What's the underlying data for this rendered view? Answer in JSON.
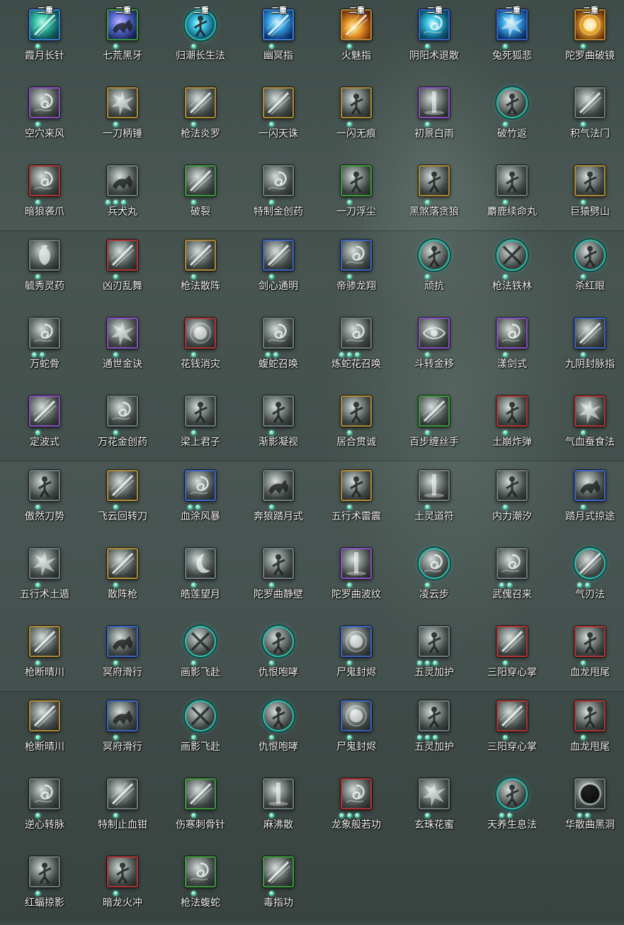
{
  "rows": [
    [
      {
        "label": "霞月长针",
        "tier": "二重",
        "shape": "square",
        "color": "c-teal",
        "border": "b-cyanblue",
        "dots": 1,
        "glyph": "slash"
      },
      {
        "label": "七荒黑牙",
        "tier": "二重",
        "shape": "square",
        "color": "c-purple",
        "border": "b-green",
        "dots": 1,
        "glyph": "beast"
      },
      {
        "label": "归潮长生法",
        "tier": "二重",
        "shape": "round",
        "color": "c-cyan",
        "border": "",
        "dots": 1,
        "glyph": "figure"
      },
      {
        "label": "幽冥指",
        "tier": "二重",
        "shape": "square",
        "color": "c-blue",
        "border": "b-cyanblue",
        "dots": 1,
        "glyph": "slash"
      },
      {
        "label": "火魅指",
        "tier": "二重",
        "shape": "square",
        "color": "c-orange",
        "border": "b-gold",
        "dots": 1,
        "glyph": "slash"
      },
      {
        "label": "阴阳术退散",
        "tier": "二重",
        "shape": "square",
        "color": "c-cyan",
        "border": "b-blue",
        "dots": 1,
        "glyph": "swirl"
      },
      {
        "label": "兔死狐悲",
        "tier": "二重",
        "shape": "square",
        "color": "c-blue",
        "border": "b-blue",
        "dots": 1,
        "glyph": "burst"
      },
      {
        "label": "陀罗曲破镜",
        "tier": "二重",
        "shape": "square",
        "color": "c-gold",
        "border": "b-gold",
        "dots": 1,
        "glyph": "orb"
      }
    ],
    [
      {
        "label": "空穴来风",
        "tier": "",
        "shape": "square",
        "color": "",
        "border": "b-purple",
        "dots": 1,
        "glyph": "swirl"
      },
      {
        "label": "一刀柄锤",
        "tier": "",
        "shape": "square",
        "color": "",
        "border": "b-gold",
        "dots": 1,
        "glyph": "burst"
      },
      {
        "label": "枪法炎罗",
        "tier": "",
        "shape": "square",
        "color": "",
        "border": "b-gold",
        "dots": 1,
        "glyph": "slash"
      },
      {
        "label": "一闪天诛",
        "tier": "",
        "shape": "square",
        "color": "",
        "border": "b-gold",
        "dots": 1,
        "glyph": "slash"
      },
      {
        "label": "一闪无痕",
        "tier": "",
        "shape": "square",
        "color": "",
        "border": "b-gold",
        "dots": 1,
        "glyph": "figure"
      },
      {
        "label": "初景白雨",
        "tier": "",
        "shape": "square",
        "color": "",
        "border": "b-purple",
        "dots": 1,
        "glyph": "pillar"
      },
      {
        "label": "破竹返",
        "tier": "",
        "shape": "round",
        "color": "",
        "border": "",
        "dots": 1,
        "glyph": "figure"
      },
      {
        "label": "积气法门",
        "tier": "",
        "shape": "square",
        "color": "",
        "border": "b-gray",
        "dots": 1,
        "glyph": "slash"
      }
    ],
    [
      {
        "label": "暗狼袭爪",
        "tier": "",
        "shape": "square",
        "color": "",
        "border": "b-red",
        "dots": 1,
        "glyph": "swirl"
      },
      {
        "label": "兵犬丸",
        "tier": "",
        "shape": "square",
        "color": "",
        "border": "b-gray",
        "dots": 3,
        "glyph": "beast"
      },
      {
        "label": "破裂",
        "tier": "",
        "shape": "square",
        "color": "",
        "border": "b-green",
        "dots": 1,
        "glyph": "slash"
      },
      {
        "label": "特制金创药",
        "tier": "",
        "shape": "square",
        "color": "",
        "border": "b-gray",
        "dots": 1,
        "glyph": "swirl"
      },
      {
        "label": "一刀浮尘",
        "tier": "",
        "shape": "square",
        "color": "",
        "border": "b-green",
        "dots": 1,
        "glyph": "figure"
      },
      {
        "label": "黑煞落贪狼",
        "tier": "",
        "shape": "square",
        "color": "",
        "border": "b-gold",
        "dots": 1,
        "glyph": "figure"
      },
      {
        "label": "麝鹿续命丸",
        "tier": "",
        "shape": "square",
        "color": "",
        "border": "b-gray",
        "dots": 1,
        "glyph": "figure"
      },
      {
        "label": "巨猿劈山",
        "tier": "",
        "shape": "square",
        "color": "",
        "border": "b-gold",
        "dots": 1,
        "glyph": "figure"
      }
    ],
    [
      {
        "label": "毓秀灵药",
        "tier": "",
        "shape": "square",
        "color": "",
        "border": "b-gray",
        "dots": 1,
        "glyph": "vase"
      },
      {
        "label": "凶刃乱舞",
        "tier": "",
        "shape": "square",
        "color": "",
        "border": "b-red",
        "dots": 1,
        "glyph": "slash"
      },
      {
        "label": "枪法散阵",
        "tier": "",
        "shape": "square",
        "color": "",
        "border": "b-gold",
        "dots": 1,
        "glyph": "slash"
      },
      {
        "label": "剑心通明",
        "tier": "",
        "shape": "square",
        "color": "",
        "border": "b-blue",
        "dots": 1,
        "glyph": "slash"
      },
      {
        "label": "帝骖龙翔",
        "tier": "",
        "shape": "square",
        "color": "",
        "border": "b-blue",
        "dots": 1,
        "glyph": "swirl"
      },
      {
        "label": "顽抗",
        "tier": "",
        "shape": "round",
        "color": "",
        "border": "",
        "dots": 1,
        "glyph": "figure"
      },
      {
        "label": "枪法铁林",
        "tier": "",
        "shape": "round",
        "color": "",
        "border": "",
        "dots": 1,
        "glyph": "cross"
      },
      {
        "label": "杀红眼",
        "tier": "",
        "shape": "round",
        "color": "",
        "border": "",
        "dots": 1,
        "glyph": "figure"
      }
    ],
    [
      {
        "label": "万蛇骨",
        "tier": "",
        "shape": "square",
        "color": "",
        "border": "b-gray",
        "dots": 2,
        "glyph": "swirl"
      },
      {
        "label": "通世金诀",
        "tier": "",
        "shape": "square",
        "color": "",
        "border": "b-purple",
        "dots": 1,
        "glyph": "burst"
      },
      {
        "label": "花钱消灾",
        "tier": "",
        "shape": "square",
        "color": "",
        "border": "b-red",
        "dots": 1,
        "glyph": "orb"
      },
      {
        "label": "蝮蛇召唤",
        "tier": "",
        "shape": "square",
        "color": "",
        "border": "b-gray",
        "dots": 2,
        "glyph": "swirl"
      },
      {
        "label": "炼蛇花召唤",
        "tier": "",
        "shape": "square",
        "color": "",
        "border": "b-gray",
        "dots": 3,
        "glyph": "swirl"
      },
      {
        "label": "斗转金移",
        "tier": "",
        "shape": "square",
        "color": "",
        "border": "b-purple",
        "dots": 1,
        "glyph": "eye"
      },
      {
        "label": "漾剑式",
        "tier": "",
        "shape": "square",
        "color": "",
        "border": "b-purple",
        "dots": 1,
        "glyph": "swirl"
      },
      {
        "label": "九阴封脉指",
        "tier": "",
        "shape": "square",
        "color": "",
        "border": "b-blue",
        "dots": 1,
        "glyph": "slash"
      }
    ],
    [
      {
        "label": "定波式",
        "tier": "",
        "shape": "square",
        "color": "",
        "border": "b-purple",
        "dots": 1,
        "glyph": "slash"
      },
      {
        "label": "万花金创药",
        "tier": "",
        "shape": "square",
        "color": "",
        "border": "b-gray",
        "dots": 1,
        "glyph": "swirl"
      },
      {
        "label": "梁上君子",
        "tier": "",
        "shape": "square",
        "color": "",
        "border": "b-gray",
        "dots": 1,
        "glyph": "figure"
      },
      {
        "label": "渐影凝视",
        "tier": "",
        "shape": "square",
        "color": "",
        "border": "b-gray",
        "dots": 1,
        "glyph": "figure"
      },
      {
        "label": "居合贯诚",
        "tier": "",
        "shape": "square",
        "color": "",
        "border": "b-gold",
        "dots": 1,
        "glyph": "figure"
      },
      {
        "label": "百步缠丝手",
        "tier": "",
        "shape": "square",
        "color": "",
        "border": "b-green",
        "dots": 1,
        "glyph": "slash"
      },
      {
        "label": "土崩炸弹",
        "tier": "",
        "shape": "square",
        "color": "",
        "border": "b-red",
        "dots": 1,
        "glyph": "figure"
      },
      {
        "label": "气血蚕食法",
        "tier": "",
        "shape": "square",
        "color": "",
        "border": "b-red",
        "dots": 1,
        "glyph": "burst"
      }
    ],
    [
      {
        "label": "傲然刀势",
        "tier": "",
        "shape": "square",
        "color": "",
        "border": "b-gray",
        "dots": 1,
        "glyph": "figure"
      },
      {
        "label": "飞云回转刀",
        "tier": "",
        "shape": "square",
        "color": "",
        "border": "b-gold",
        "dots": 1,
        "glyph": "slash"
      },
      {
        "label": "血涂风暴",
        "tier": "",
        "shape": "square",
        "color": "",
        "border": "b-blue",
        "dots": 2,
        "glyph": "swirl"
      },
      {
        "label": "奔狼踏月式",
        "tier": "",
        "shape": "square",
        "color": "",
        "border": "b-gray",
        "dots": 1,
        "glyph": "beast"
      },
      {
        "label": "五行术雷震",
        "tier": "",
        "shape": "square",
        "color": "",
        "border": "b-gold",
        "dots": 1,
        "glyph": "figure"
      },
      {
        "label": "土灵道符",
        "tier": "",
        "shape": "square",
        "color": "",
        "border": "b-gray",
        "dots": 1,
        "glyph": "pillar"
      },
      {
        "label": "内力潮汐",
        "tier": "",
        "shape": "square",
        "color": "",
        "border": "b-gray",
        "dots": 1,
        "glyph": "figure"
      },
      {
        "label": "踏月式掠途",
        "tier": "",
        "shape": "square",
        "color": "",
        "border": "b-blue",
        "dots": 1,
        "glyph": "beast"
      }
    ],
    [
      {
        "label": "五行术土遁",
        "tier": "",
        "shape": "square",
        "color": "",
        "border": "b-gray",
        "dots": 1,
        "glyph": "burst"
      },
      {
        "label": "散阵枪",
        "tier": "",
        "shape": "square",
        "color": "",
        "border": "b-gold",
        "dots": 1,
        "glyph": "slash"
      },
      {
        "label": "皓莲望月",
        "tier": "",
        "shape": "square",
        "color": "",
        "border": "b-gray",
        "dots": 1,
        "glyph": "moon"
      },
      {
        "label": "陀罗曲静壁",
        "tier": "",
        "shape": "square",
        "color": "",
        "border": "b-gray",
        "dots": 1,
        "glyph": "figure"
      },
      {
        "label": "陀罗曲波纹",
        "tier": "",
        "shape": "square",
        "color": "",
        "border": "b-purple",
        "dots": 1,
        "glyph": "pillar"
      },
      {
        "label": "凌云步",
        "tier": "",
        "shape": "round",
        "color": "",
        "border": "",
        "dots": 1,
        "glyph": "swirl"
      },
      {
        "label": "武傀召来",
        "tier": "",
        "shape": "square",
        "color": "",
        "border": "b-gray",
        "dots": 2,
        "glyph": "swirl"
      },
      {
        "label": "气刃法",
        "tier": "",
        "shape": "round",
        "color": "",
        "border": "",
        "dots": 2,
        "glyph": "slash"
      }
    ],
    [
      {
        "label": "枪断晴川",
        "tier": "",
        "shape": "square",
        "color": "",
        "border": "b-gold",
        "dots": 1,
        "glyph": "slash"
      },
      {
        "label": "冥府滑行",
        "tier": "",
        "shape": "square",
        "color": "",
        "border": "b-blue",
        "dots": 1,
        "glyph": "beast"
      },
      {
        "label": "画影飞赴",
        "tier": "",
        "shape": "round",
        "color": "",
        "border": "",
        "dots": 1,
        "glyph": "cross"
      },
      {
        "label": "仇恨咆哮",
        "tier": "",
        "shape": "round",
        "color": "",
        "border": "",
        "dots": 1,
        "glyph": "figure"
      },
      {
        "label": "尸鬼封烬",
        "tier": "",
        "shape": "square",
        "color": "",
        "border": "b-blue",
        "dots": 1,
        "glyph": "orb"
      },
      {
        "label": "五灵加护",
        "tier": "",
        "shape": "square",
        "color": "",
        "border": "b-gray",
        "dots": 3,
        "glyph": "figure"
      },
      {
        "label": "三阳穿心掌",
        "tier": "",
        "shape": "square",
        "color": "",
        "border": "b-red",
        "dots": 1,
        "glyph": "slash"
      },
      {
        "label": "血龙甩尾",
        "tier": "",
        "shape": "square",
        "color": "",
        "border": "b-red",
        "dots": 1,
        "glyph": "figure"
      }
    ],
    [
      {
        "label": "枪断晴川",
        "tier": "",
        "shape": "square",
        "color": "",
        "border": "b-gold",
        "dots": 1,
        "glyph": "slash"
      },
      {
        "label": "冥府滑行",
        "tier": "",
        "shape": "square",
        "color": "",
        "border": "b-blue",
        "dots": 1,
        "glyph": "beast"
      },
      {
        "label": "画影飞赴",
        "tier": "",
        "shape": "round",
        "color": "",
        "border": "",
        "dots": 1,
        "glyph": "cross"
      },
      {
        "label": "仇恨咆哮",
        "tier": "",
        "shape": "round",
        "color": "",
        "border": "",
        "dots": 1,
        "glyph": "figure"
      },
      {
        "label": "尸鬼封烬",
        "tier": "",
        "shape": "square",
        "color": "",
        "border": "b-blue",
        "dots": 1,
        "glyph": "orb"
      },
      {
        "label": "五灵加护",
        "tier": "",
        "shape": "square",
        "color": "",
        "border": "b-gray",
        "dots": 3,
        "glyph": "figure"
      },
      {
        "label": "三阳穿心掌",
        "tier": "",
        "shape": "square",
        "color": "",
        "border": "b-red",
        "dots": 1,
        "glyph": "slash"
      },
      {
        "label": "血龙甩尾",
        "tier": "",
        "shape": "square",
        "color": "",
        "border": "b-red",
        "dots": 1,
        "glyph": "figure"
      }
    ],
    [
      {
        "label": "逆心转脉",
        "tier": "",
        "shape": "square",
        "color": "",
        "border": "b-gray",
        "dots": 1,
        "glyph": "swirl"
      },
      {
        "label": "特制止血钳",
        "tier": "",
        "shape": "square",
        "color": "",
        "border": "b-gray",
        "dots": 1,
        "glyph": "slash"
      },
      {
        "label": "伤寒刺骨针",
        "tier": "",
        "shape": "square",
        "color": "",
        "border": "b-green",
        "dots": 1,
        "glyph": "slash"
      },
      {
        "label": "麻沸散",
        "tier": "",
        "shape": "square",
        "color": "",
        "border": "b-gray",
        "dots": 1,
        "glyph": "pillar"
      },
      {
        "label": "龙象般若功",
        "tier": "",
        "shape": "square",
        "color": "",
        "border": "b-red",
        "dots": 3,
        "glyph": "swirl"
      },
      {
        "label": "玄珠花蜜",
        "tier": "",
        "shape": "square",
        "color": "",
        "border": "b-gray",
        "dots": 1,
        "glyph": "burst"
      },
      {
        "label": "天养生息法",
        "tier": "",
        "shape": "round",
        "color": "",
        "border": "",
        "dots": 2,
        "glyph": "figure"
      },
      {
        "label": "华散曲黑洞",
        "tier": "",
        "shape": "square",
        "color": "",
        "border": "b-gray",
        "dots": 2,
        "glyph": "hole"
      }
    ],
    [
      {
        "label": "红蝠掠影",
        "tier": "",
        "shape": "square",
        "color": "",
        "border": "b-gray",
        "dots": 1,
        "glyph": "figure"
      },
      {
        "label": "暗龙火冲",
        "tier": "",
        "shape": "square",
        "color": "",
        "border": "b-red",
        "dots": 1,
        "glyph": "figure"
      },
      {
        "label": "枪法蝮蛇",
        "tier": "",
        "shape": "square",
        "color": "",
        "border": "b-green",
        "dots": 1,
        "glyph": "swirl"
      },
      {
        "label": "毒指功",
        "tier": "",
        "shape": "square",
        "color": "",
        "border": "b-green",
        "dots": 1,
        "glyph": "slash"
      }
    ]
  ]
}
